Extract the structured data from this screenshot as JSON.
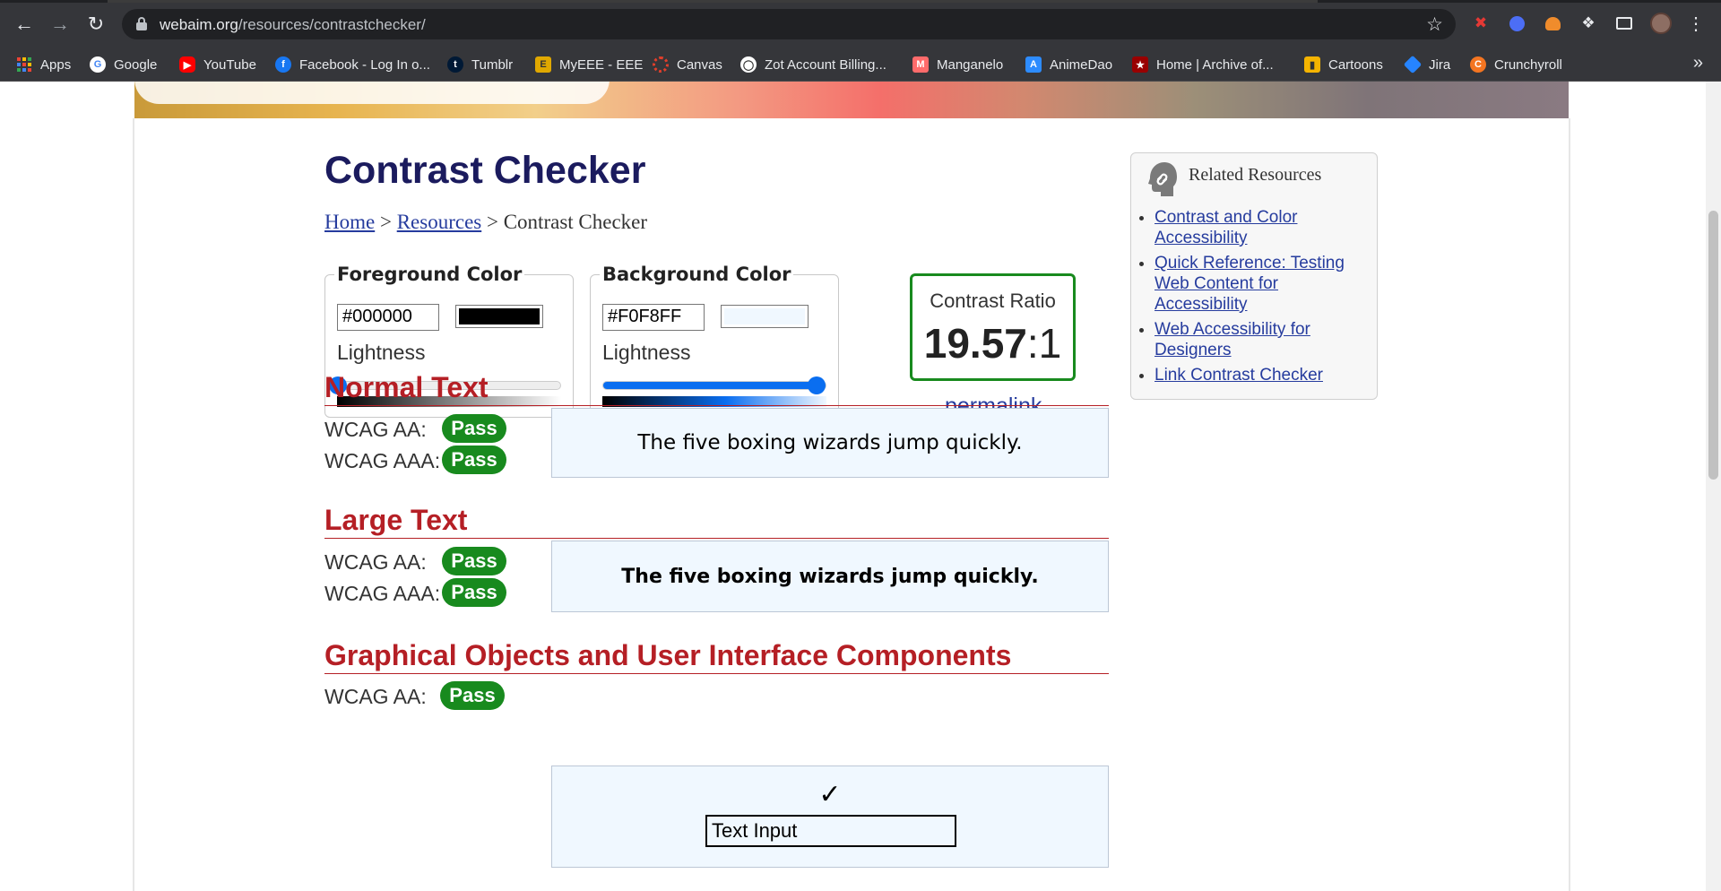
{
  "browser": {
    "url_host": "webaim.org",
    "url_path": "/resources/contrastchecker/",
    "bookmarks": [
      {
        "label": "Apps",
        "icon": "apps-grid-icon",
        "color": "#4285f4"
      },
      {
        "label": "Google",
        "icon": "google-icon",
        "color": "#ffffff"
      },
      {
        "label": "YouTube",
        "icon": "youtube-icon",
        "color": "#ff0000"
      },
      {
        "label": "Facebook - Log In o...",
        "icon": "facebook-icon",
        "color": "#1877f2"
      },
      {
        "label": "Tumblr",
        "icon": "tumblr-icon",
        "color": "#001935"
      },
      {
        "label": "MyEEE - EEE",
        "icon": "myeee-icon",
        "color": "#e0a800"
      },
      {
        "label": "Canvas",
        "icon": "canvas-icon",
        "color": "#e13f2b"
      },
      {
        "label": "Zot Account Billing...",
        "icon": "zot-icon",
        "color": "#ffffff"
      },
      {
        "label": "Manganelo",
        "icon": "manganelo-icon",
        "color": "#ff6b6b"
      },
      {
        "label": "AnimeDao",
        "icon": "animedao-icon",
        "color": "#2d8cff"
      },
      {
        "label": "Home | Archive of...",
        "icon": "ao3-icon",
        "color": "#990000"
      },
      {
        "label": "Cartoons",
        "icon": "cartoons-icon",
        "color": "#f5b400"
      },
      {
        "label": "Jira",
        "icon": "jira-icon",
        "color": "#2684ff"
      },
      {
        "label": "Crunchyroll",
        "icon": "crunchyroll-icon",
        "color": "#f47521"
      }
    ],
    "more_label": "»"
  },
  "page": {
    "title": "Contrast Checker",
    "breadcrumb": {
      "home": "Home",
      "sep": " > ",
      "resources": "Resources",
      "current": "Contrast Checker"
    },
    "foreground": {
      "legend": "Foreground Color",
      "hex": "#000000",
      "swatch_color": "#000000",
      "lightness_label": "Lightness",
      "lightness_value": 0
    },
    "background": {
      "legend": "Background Color",
      "hex": "#F0F8FF",
      "swatch_color": "#F0F8FF",
      "lightness_label": "Lightness",
      "lightness_value": 0.96
    },
    "contrast": {
      "label": "Contrast Ratio",
      "value": "19.57",
      "suffix": ":1",
      "permalink": "permalink"
    },
    "related": {
      "title": "Related Resources",
      "links": [
        "Contrast and Color Accessibility",
        "Quick Reference: Testing Web Content for Accessibility",
        "Web Accessibility for Designers",
        "Link Contrast Checker"
      ]
    },
    "normal_text": {
      "heading": "Normal Text",
      "aa_label": "WCAG AA:",
      "aa_result": "Pass",
      "aaa_label": "WCAG AAA:",
      "aaa_result": "Pass",
      "sample": "The five boxing wizards jump quickly."
    },
    "large_text": {
      "heading": "Large Text",
      "aa_label": "WCAG AA:",
      "aa_result": "Pass",
      "aaa_label": "WCAG AAA:",
      "aaa_result": "Pass",
      "sample": "The five boxing wizards jump quickly."
    },
    "graphical": {
      "heading": "Graphical Objects and User Interface Components",
      "aa_label": "WCAG AA:",
      "aa_result": "Pass",
      "check": "✓",
      "input_value": "Text Input"
    }
  },
  "colors": {
    "accent_heading": "#b51f25",
    "pass_green": "#188a1e",
    "link_blue": "#263c9e",
    "title_navy": "#1b1b5e",
    "slider_blue": "#0a6ef0"
  }
}
